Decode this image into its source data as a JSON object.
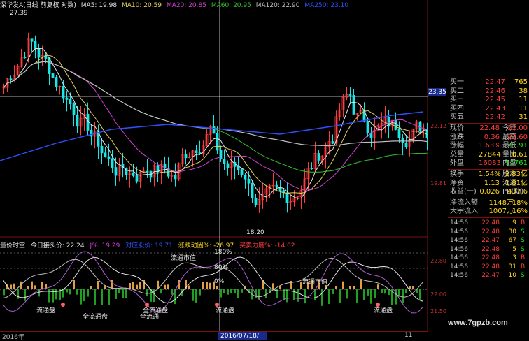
{
  "header": {
    "stock_title": "深华发A(日线 前复权 对数)",
    "ma5": "MA5: 19.98",
    "ma10": "MA10: 20.59",
    "ma20": "MA20: 20.85",
    "ma60": "MA60: 20.95",
    "ma120": "MA120: 22.90",
    "ma250": "MA250: 23.10",
    "high_marker": "27.39"
  },
  "colors": {
    "up": "#ff3b3b",
    "down": "#19e6e6",
    "ma5": "#e6e6e6",
    "ma10": "#e6d060",
    "ma20": "#d040d0",
    "ma60": "#30c030",
    "ma120": "#c0c0c0",
    "ma250": "#3050ff"
  },
  "main_axis": {
    "tag": "23.35",
    "label_mid": "22.12",
    "label_low": "19.81"
  },
  "annotations": {
    "low_price": "18.20"
  },
  "sub_header": {
    "title": "量价时空",
    "today_price": "今日接头价: 22.24",
    "j": "J%: 19.29",
    "ref": "对应股价: 19.71",
    "ratio": "涨跌动因%: -26.97",
    "buy": "买卖力度%: -14.02"
  },
  "sub_annotations": {
    "p180": "180%",
    "p80": "80%",
    "p0": "0%",
    "liutong1": "流通市值",
    "liutong2": "流通市值",
    "plate1": "流通盘",
    "plate2": "全流通盘",
    "plate3": "全流通",
    "plate4": "全流通盘",
    "plate5": "流通盘",
    "plate6": "流通盘"
  },
  "sub_axis": {
    "top": "22.80",
    "mid": "22.00",
    "low": "21.50"
  },
  "bottom": {
    "label_left": "2016年",
    "cursor_date": "2016/07/18/一",
    "right_label": "11"
  },
  "panel": {
    "orders": [
      {
        "label": "买一",
        "price": "22.47",
        "vol": "765"
      },
      {
        "label": "买二",
        "price": "22.46",
        "vol": "38"
      },
      {
        "label": "买三",
        "price": "22.45",
        "vol": "11"
      },
      {
        "label": "买四",
        "price": "22.43",
        "vol": "11"
      },
      {
        "label": "买五",
        "price": "22.42",
        "vol": "31"
      }
    ],
    "quote": [
      {
        "k": "现价",
        "v": "22.48",
        "k2": "今开",
        "v3": "22.00",
        "c": "red",
        "c3": "red"
      },
      {
        "k": "涨跌",
        "v": "0.36",
        "k2": "最高",
        "v3": "22.60",
        "c": "red",
        "c3": "red"
      },
      {
        "k": "涨幅",
        "v": "1.63%",
        "k2": "最低",
        "v3": "21.91",
        "c": "red",
        "c3": "green"
      },
      {
        "k": "总量",
        "v": "27844",
        "k2": "量比",
        "v3": "0.61",
        "c": "yellow",
        "c3": "yellow"
      },
      {
        "k": "外盘",
        "v": "16083",
        "k2": "内盘",
        "v3": "11761",
        "c": "red",
        "c3": "green"
      }
    ],
    "stats": [
      {
        "k": "换手",
        "v": "1.54%",
        "k2": "股本",
        "v3": "2.83亿",
        "c": "yellow",
        "c3": "yellow"
      },
      {
        "k": "净资",
        "v": "1.13",
        "k2": "流通",
        "v3": "1.81亿",
        "c": "yellow",
        "c3": "yellow"
      },
      {
        "k": "收益(一)",
        "v": "0.026",
        "k2": "PE(动)",
        "v3": "437.6",
        "c": "yellow",
        "c3": "yellow"
      }
    ],
    "flows": [
      {
        "k": "净流入额",
        "v": "1148万",
        "pct": "18%"
      },
      {
        "k": "大宗流入",
        "v": "1007万",
        "pct": "16%"
      }
    ],
    "ticks": [
      {
        "t": "14:56",
        "p": "22.48",
        "q": "9",
        "s": "B"
      },
      {
        "t": "14:56",
        "p": "22.48",
        "q": "30",
        "s": "S"
      },
      {
        "t": "14:56",
        "p": "22.47",
        "q": "67",
        "s": "S"
      },
      {
        "t": "14:56",
        "p": "22.48",
        "q": "5",
        "s": "S"
      },
      {
        "t": "14:56",
        "p": "22.48",
        "q": "3",
        "s": "B"
      },
      {
        "t": "14:56",
        "p": "22.48",
        "q": "31",
        "s": "B"
      },
      {
        "t": "14:56",
        "p": "22.47",
        "q": "10",
        "s": "S"
      }
    ]
  },
  "watermark": "www.7gpzb.com"
}
